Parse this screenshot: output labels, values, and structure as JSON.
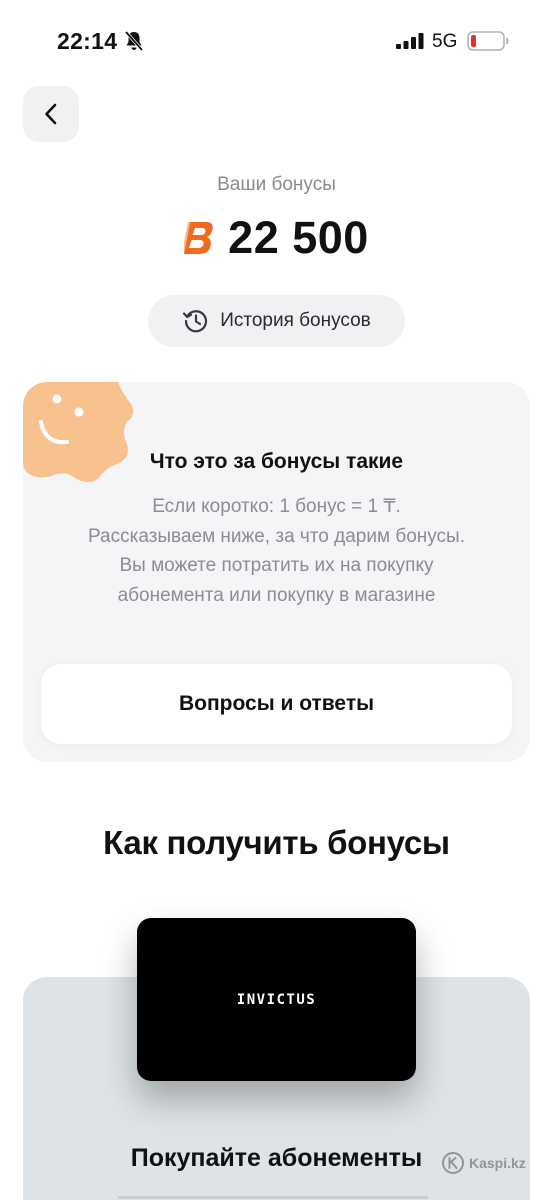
{
  "status_bar": {
    "time": "22:14",
    "network": "5G",
    "battery_level": 0.15,
    "battery_color": "#e0312f"
  },
  "header": {
    "back_icon": "chevron-left-icon"
  },
  "balance": {
    "caption": "Ваши бонусы",
    "amount": "22 500",
    "currency_icon": "bonus-b-icon",
    "accent_color": "#f26a1d"
  },
  "history": {
    "label": "История бонусов",
    "icon": "history-clock-icon"
  },
  "info": {
    "title": "Что это за бонусы такие",
    "lines": [
      "Если коротко: 1 бонус = 1 ₸.",
      "Рассказываем ниже, за что дарим бонусы.",
      "Вы можете потратить их на покупку",
      "абонемента или покупку в магазине"
    ],
    "faq_label": "Вопросы и ответы",
    "illustration_color": "#f8c28e"
  },
  "how_to": {
    "heading": "Как получить бонусы",
    "card_brand": "INVICTUS",
    "card_title": "Покупайте абонементы"
  },
  "watermark": {
    "text": "Kaspi.kz"
  }
}
